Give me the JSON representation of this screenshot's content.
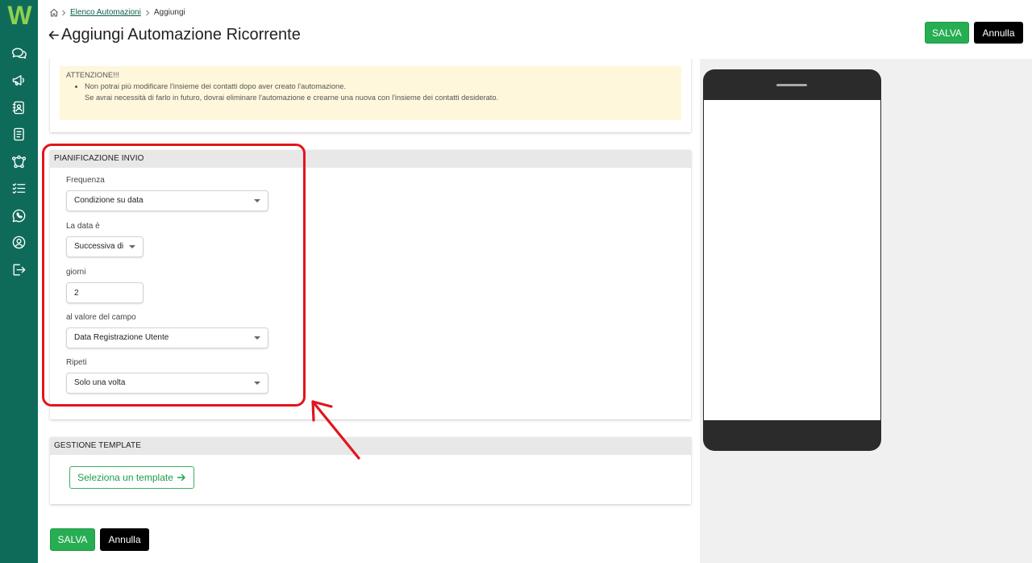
{
  "sidebar": {
    "logo_text": "W",
    "items": [
      {
        "icon": "chat-icon"
      },
      {
        "icon": "megaphone-icon"
      },
      {
        "icon": "contacts-book-icon"
      },
      {
        "icon": "document-icon"
      },
      {
        "icon": "flow-network-icon"
      },
      {
        "icon": "checklist-icon"
      },
      {
        "icon": "whatsapp-icon"
      },
      {
        "icon": "user-circle-icon"
      },
      {
        "icon": "logout-icon"
      }
    ]
  },
  "breadcrumb": {
    "home_icon": "home-icon",
    "separator_icon": "chevron-right-icon",
    "items": [
      {
        "label": "Elenco Automazioni"
      },
      {
        "label": "Aggiungi"
      }
    ]
  },
  "header": {
    "back_icon": "arrow-left-icon",
    "title": "Aggiungi Automazione Ricorrente",
    "save_label": "SALVA",
    "cancel_label": "Annulla"
  },
  "warning": {
    "title": "ATTENZIONE!!!",
    "bullet_line_1": "Non potrai più modificare l'insieme dei contatti dopo aver creato l'automazione.",
    "bullet_line_2": "Se avrai necessità di farlo in futuro, dovrai eliminare l'automazione e crearne una nuova con l'insieme dei contatti desiderato."
  },
  "schedule": {
    "title": "PIANIFICAZIONE INVIO",
    "frequency": {
      "label": "Frequenza",
      "value": "Condizione su data"
    },
    "date_relation": {
      "label": "La data è",
      "value": "Successiva di"
    },
    "days": {
      "label": "giorni",
      "value": "2"
    },
    "field": {
      "label": "al valore del campo",
      "value": "Data Registrazione Utente"
    },
    "repeat": {
      "label": "Ripeti",
      "value": "Solo una volta"
    }
  },
  "template": {
    "title": "GESTIONE TEMPLATE",
    "select_label": "Seleziona un template",
    "select_icon": "arrow-right-icon"
  },
  "footer": {
    "save_label": "SALVA",
    "cancel_label": "Annulla"
  },
  "colors": {
    "sidebar": "#0f6b59",
    "accent_green": "#27ad52",
    "link": "#0b5e4a",
    "warning_bg": "#fef7dc",
    "annotation_red": "#e3141c"
  }
}
